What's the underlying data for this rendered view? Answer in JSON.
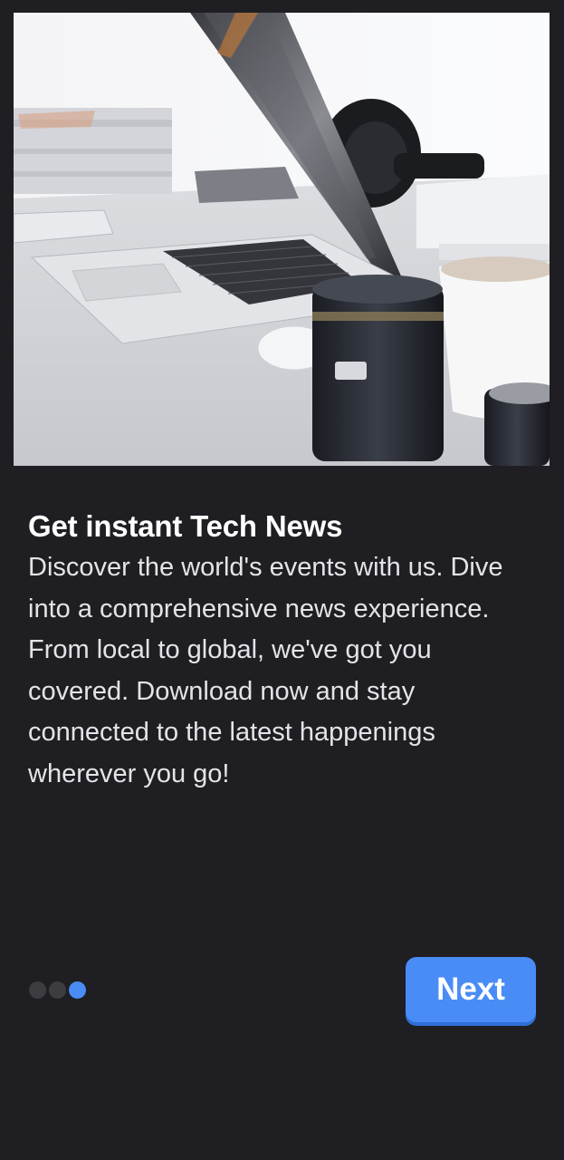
{
  "onboarding": {
    "title": "Get instant Tech News",
    "description": "Discover the world's events with us. Dive into a comprehensive news experience. From local to global, we've got you covered. Download now and stay connected to the latest happenings wherever you go!",
    "next_label": "Next",
    "page_count": 3,
    "current_page": 3
  },
  "colors": {
    "background": "#1f1e23",
    "accent": "#4a8cf5",
    "inactive_dot": "#3c3c41"
  }
}
